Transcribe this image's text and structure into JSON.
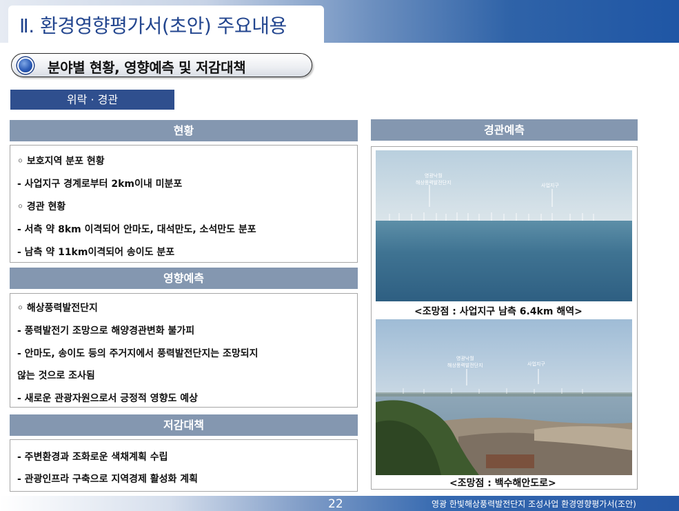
{
  "header": {
    "title": "Ⅱ. 환경영향평가서(초안) 주요내용"
  },
  "section": {
    "title": "분야별 현황, 영향예측 및 저감대책"
  },
  "tag": {
    "label": "위락 · 경관"
  },
  "left": {
    "current": {
      "header": "현황",
      "lines": [
        "◦ 보호지역 분포 현황",
        " - 사업지구 경계로부터 2km이내 미분포",
        "◦ 경관 현황",
        " - 서측 약 8km 이격되어 안마도, 대석만도, 소석만도 분포",
        " - 남측 약 11km이격되어 송이도 분포"
      ]
    },
    "impact": {
      "header": "영향예측",
      "lines": [
        "◦ 해상풍력발전단지",
        " - 풍력발전기 조망으로 해양경관변화 불가피",
        " - 안마도, 송이도 등의 주거지에서 풍력발전단지는 조망되지",
        "    않는 것으로 조사됨",
        " - 새로운 관광자원으로서 긍정적 영향도 예상"
      ]
    },
    "mitigation": {
      "header": "저감대책",
      "lines": [
        " - 주변환경과 조화로운 색채계획 수립",
        " - 관광인프라 구축으로 지역경제 활성화 계획"
      ]
    }
  },
  "right": {
    "header": "경관예측",
    "photo1": {
      "label_farm_1": "영광낙월",
      "label_farm_2": "해상풍력발전단지",
      "label_site": "사업지구",
      "caption": "<조망점 : 사업지구 남측 6.4km 해역>"
    },
    "photo2": {
      "label_farm_1": "영광낙월",
      "label_farm_2": "해상풍력발전단지",
      "label_site": "사업지구",
      "caption": "<조망점 : 백수해안도로>"
    }
  },
  "footer": {
    "page_number": "22",
    "text": "영광 한빛해상풍력발전단지 조성사업 환경영향평가서(조안)"
  },
  "colors": {
    "header_fill": "#8497b0",
    "tag_fill": "#2f4f8e",
    "title_text": "#23468f",
    "footer_blue": "#2658a6"
  }
}
